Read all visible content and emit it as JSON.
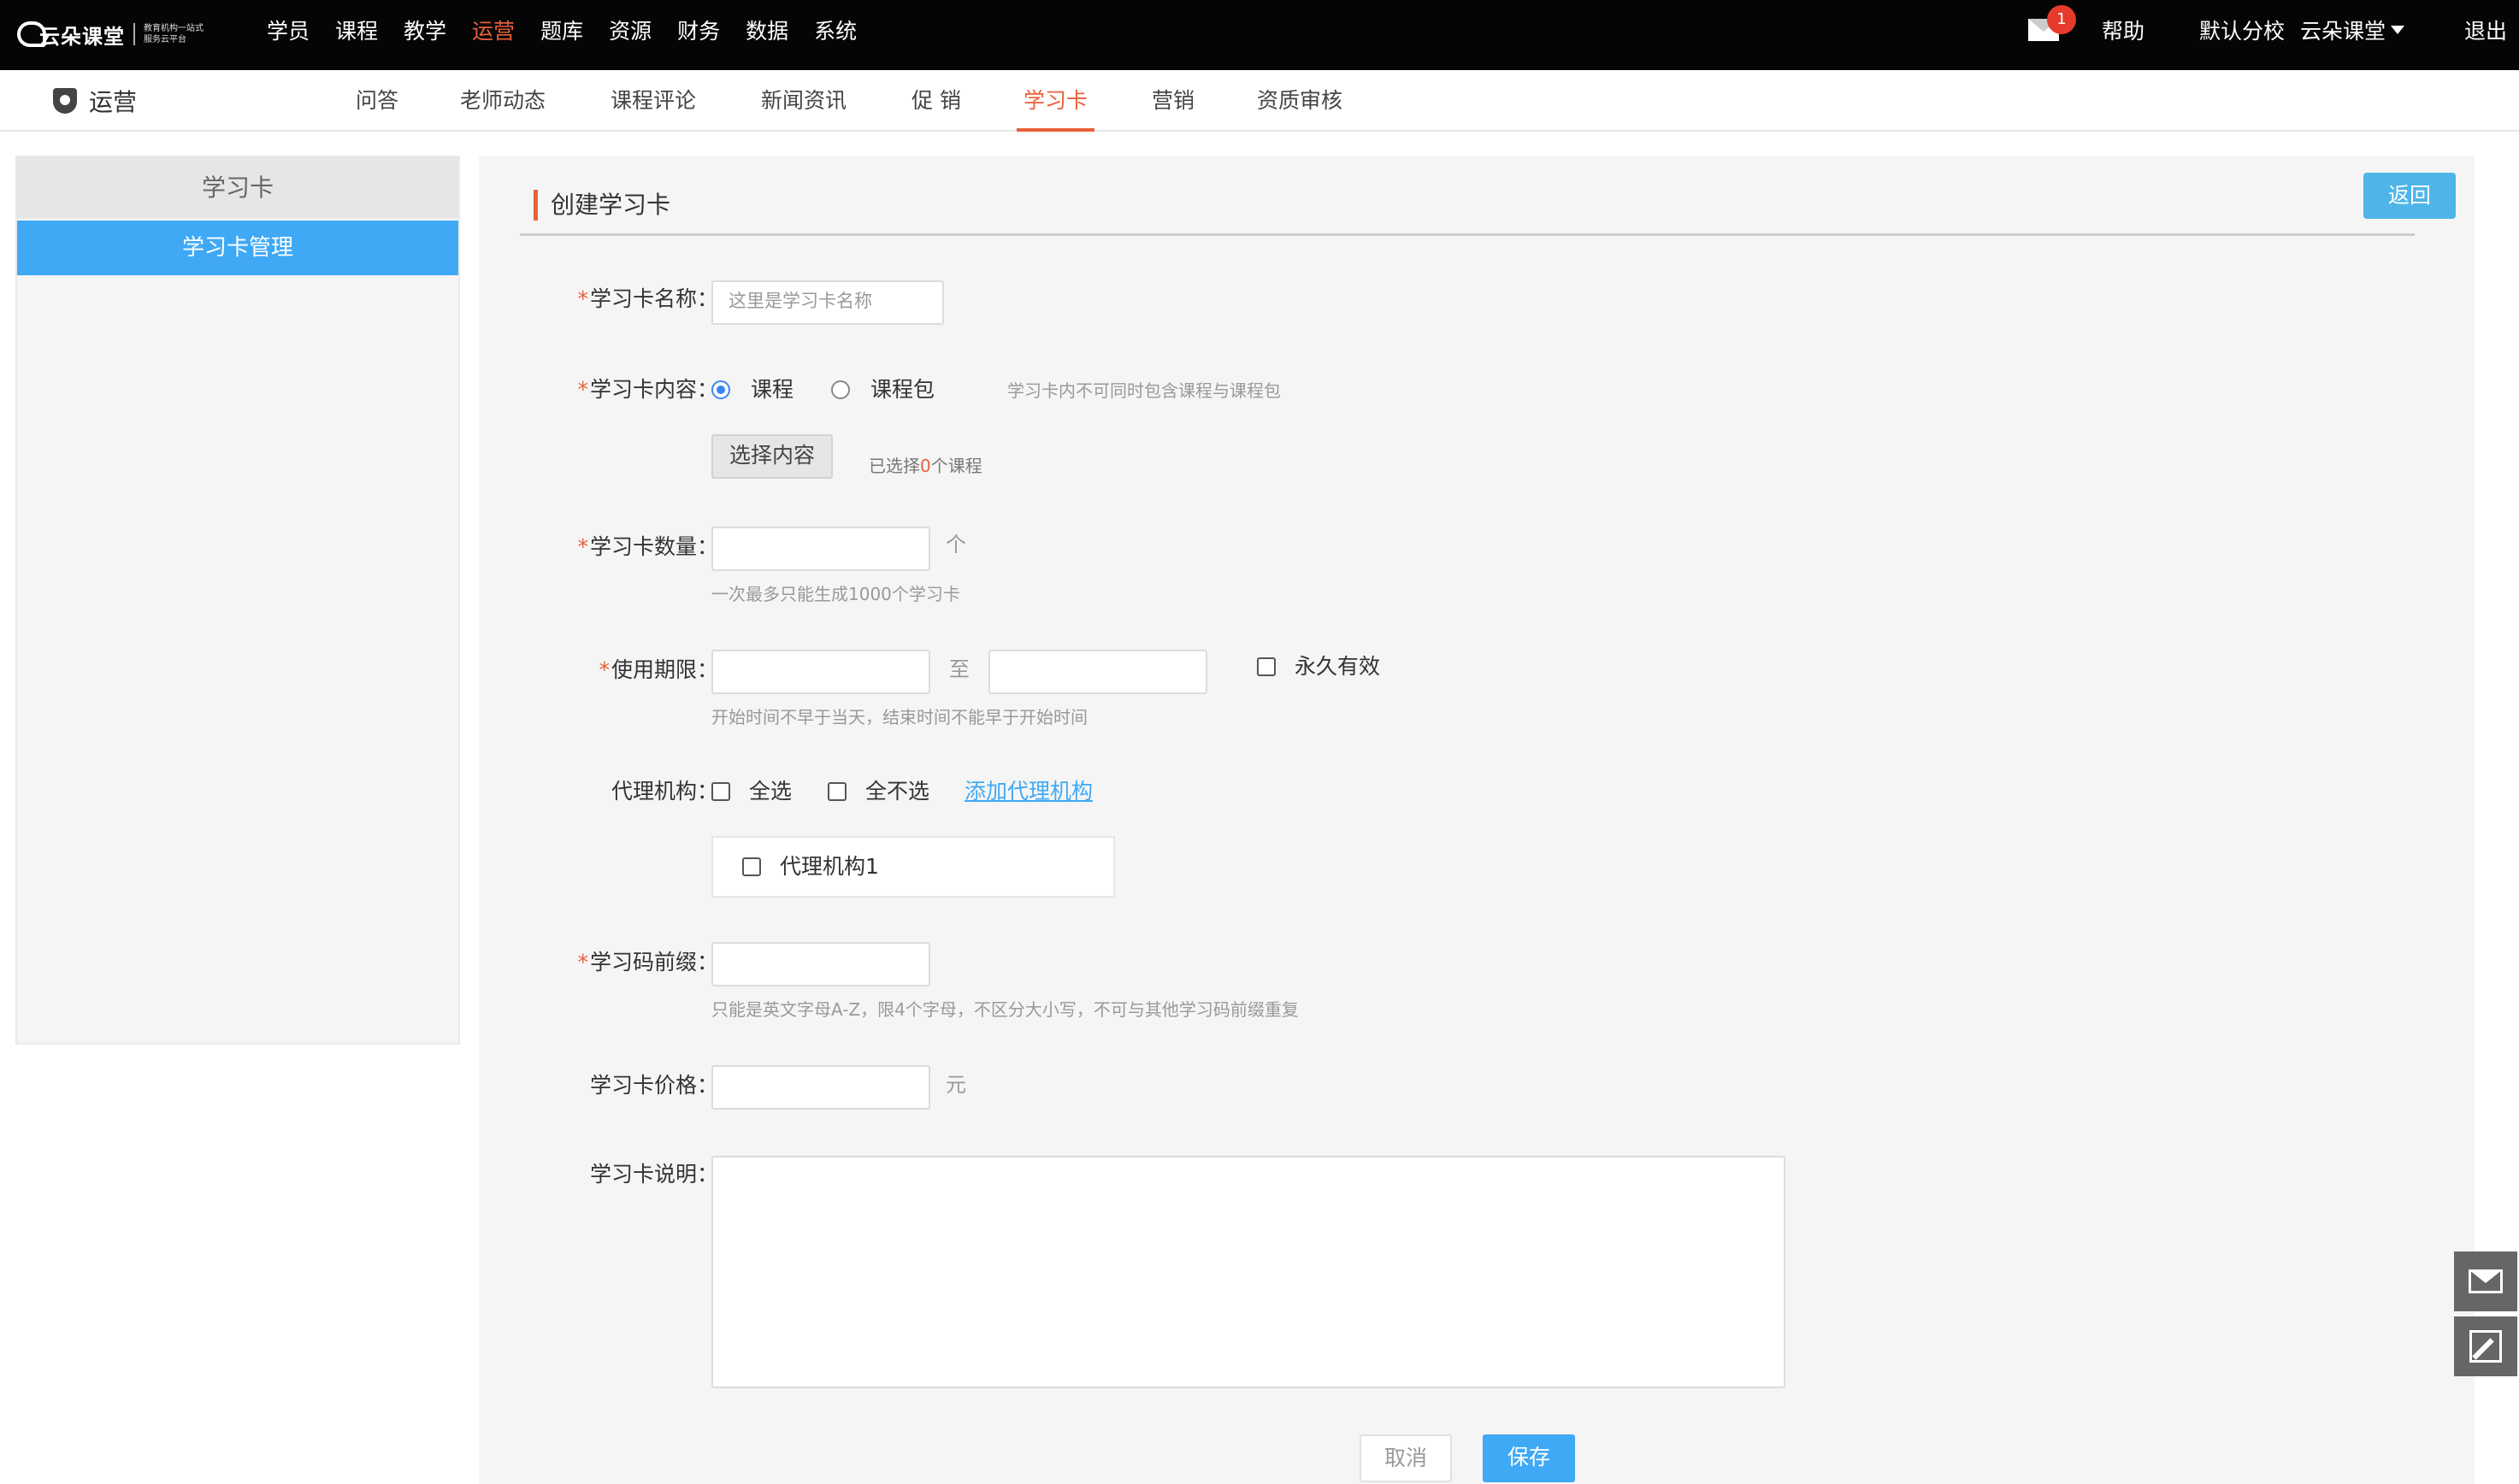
{
  "app": {
    "logo_name": "云朵课堂",
    "logo_slogan": "教育机构一站式服务云平台",
    "logo_url": "yunduoketang.com"
  },
  "topnav": {
    "items": [
      {
        "label": "学员",
        "active": false
      },
      {
        "label": "课程",
        "active": false
      },
      {
        "label": "教学",
        "active": false
      },
      {
        "label": "运营",
        "active": true
      },
      {
        "label": "题库",
        "active": false
      },
      {
        "label": "资源",
        "active": false
      },
      {
        "label": "财务",
        "active": false
      },
      {
        "label": "数据",
        "active": false
      },
      {
        "label": "系统",
        "active": false
      }
    ],
    "mail_badge": "1",
    "help": "帮助",
    "school": "默认分校",
    "account": "云朵课堂",
    "logout": "退出",
    "accent": "#e8603c"
  },
  "subnav": {
    "module": "运营",
    "tabs": [
      {
        "label": "问答",
        "active": false
      },
      {
        "label": "老师动态",
        "active": false
      },
      {
        "label": "课程评论",
        "active": false
      },
      {
        "label": "新闻资讯",
        "active": false
      },
      {
        "label": "促 销",
        "active": false
      },
      {
        "label": "学习卡",
        "active": true
      },
      {
        "label": "营销",
        "active": false
      },
      {
        "label": "资质审核",
        "active": false
      }
    ]
  },
  "sidebar": {
    "heading": "学习卡",
    "items": [
      {
        "label": "学习卡管理",
        "active": true
      }
    ],
    "active_color": "#3fa9f5"
  },
  "form": {
    "title": "创建学习卡",
    "back": "返回",
    "required_mark": "*",
    "name": {
      "label": "学习卡名称：",
      "placeholder": "这里是学习卡名称",
      "value": ""
    },
    "content": {
      "label": "学习卡内容：",
      "options": [
        {
          "label": "课程",
          "checked": true
        },
        {
          "label": "课程包",
          "checked": false
        }
      ],
      "hint": "学习卡内不可同时包含课程与课程包",
      "select_button": "选择内容",
      "selected_prefix": "已选择",
      "selected_count": "0",
      "selected_suffix": "个课程"
    },
    "quantity": {
      "label": "学习卡数量：",
      "value": "",
      "unit": "个",
      "hint": "一次最多只能生成1000个学习卡"
    },
    "period": {
      "label": "使用期限：",
      "start": "",
      "separator": "至",
      "end": "",
      "forever": {
        "label": "永久有效",
        "checked": false
      },
      "hint": "开始时间不早于当天，结束时间不能早于开始时间"
    },
    "agency": {
      "label": "代理机构：",
      "select_all": {
        "label": "全选",
        "checked": false
      },
      "select_none": {
        "label": "全不选",
        "checked": false
      },
      "add_link": "添加代理机构",
      "items": [
        {
          "label": "代理机构1",
          "checked": false
        }
      ]
    },
    "prefix": {
      "label": "学习码前缀：",
      "value": "",
      "hint": "只能是英文字母A-Z，限4个字母，不区分大小写，不可与其他学习码前缀重复"
    },
    "price": {
      "label": "学习卡价格：",
      "value": "",
      "unit": "元"
    },
    "description": {
      "label": "学习卡说明：",
      "value": ""
    },
    "cancel": "取消",
    "save": "保存"
  },
  "float_tools": [
    {
      "icon": "mail-icon"
    },
    {
      "icon": "edit-icon"
    }
  ]
}
